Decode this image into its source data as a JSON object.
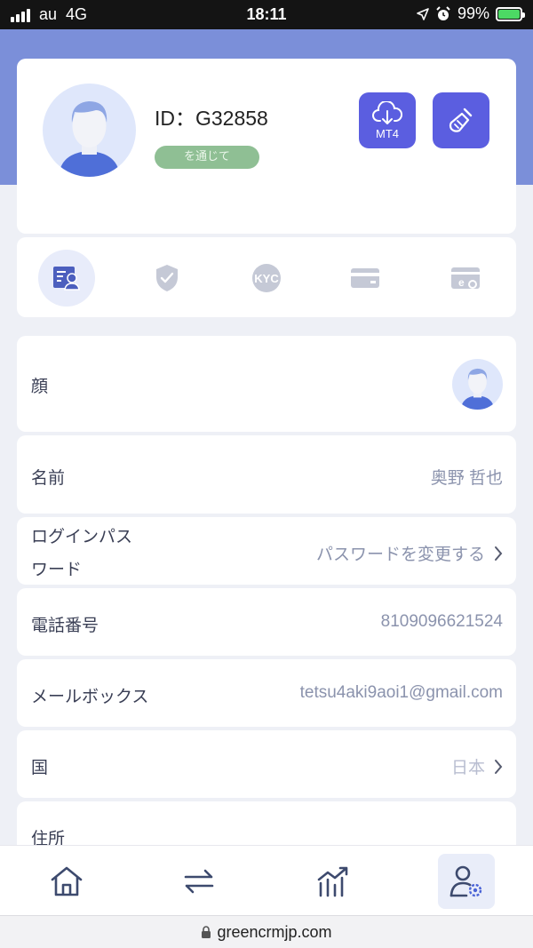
{
  "status_bar": {
    "carrier": "au",
    "network": "4G",
    "time": "18:11",
    "battery": "99%"
  },
  "profile": {
    "id_label": "ID：G32858",
    "status_badge": "を通じて",
    "mt4_label": "MT4",
    "icons": {
      "download": "cloud-download-icon",
      "clean": "broom-icon"
    }
  },
  "tabs": [
    {
      "name": "profile-info",
      "icon": "id-card-icon",
      "active": true
    },
    {
      "name": "security",
      "icon": "shield-check-icon",
      "active": false
    },
    {
      "name": "kyc",
      "icon": "kyc-icon",
      "label": "KYC",
      "active": false
    },
    {
      "name": "bank-card",
      "icon": "card-icon",
      "active": false
    },
    {
      "name": "e-wallet",
      "icon": "e-wallet-icon",
      "active": false
    }
  ],
  "fields": {
    "face": {
      "label": "顔"
    },
    "name": {
      "label": "名前",
      "value": "奥野 哲也"
    },
    "password": {
      "label_line1": "ログインパス",
      "label_line2": "ワード",
      "value": "パスワードを変更する"
    },
    "phone": {
      "label": "電話番号",
      "value": "8109096621524"
    },
    "email": {
      "label": "メールボックス",
      "value": "tetsu4aki9aoi1@gmail.com"
    },
    "country": {
      "label": "国",
      "value": "日本"
    },
    "address": {
      "label": "住所"
    }
  },
  "bottom_nav": [
    {
      "name": "home",
      "icon": "home-icon",
      "active": false
    },
    {
      "name": "transfer",
      "icon": "transfer-arrows-icon",
      "active": false
    },
    {
      "name": "market",
      "icon": "chart-icon",
      "active": false
    },
    {
      "name": "account",
      "icon": "user-settings-icon",
      "active": true
    }
  ],
  "url": "greencrmjp.com",
  "colors": {
    "accent": "#5b5ee0",
    "header_bg": "#7b8fd9",
    "badge": "#8fbf94",
    "page_bg": "#eef0f6"
  }
}
